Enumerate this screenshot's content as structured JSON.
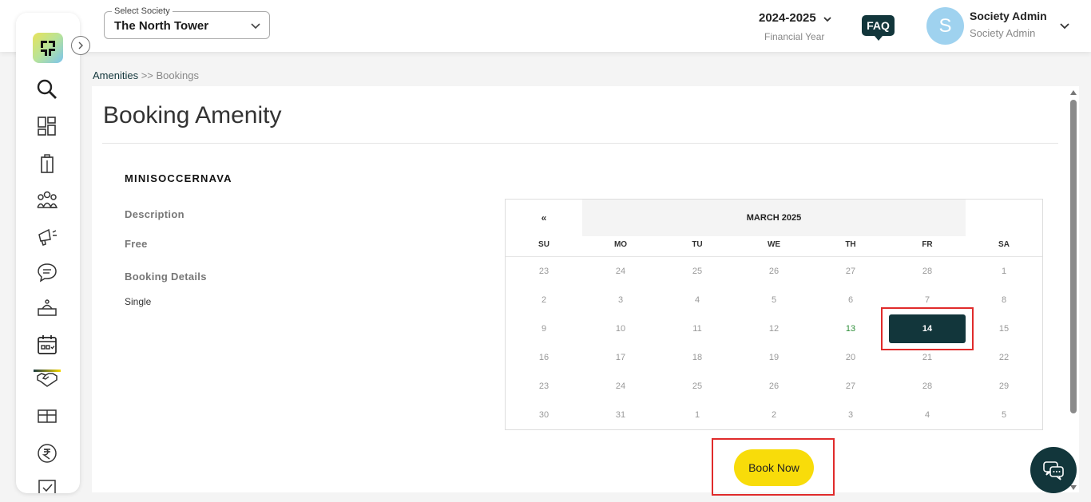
{
  "header": {
    "society_label": "Select Society",
    "society_value": "The North Tower",
    "financial_year": "2024-2025",
    "financial_year_label": "Financial Year",
    "faq_label": "FAQ",
    "avatar_initial": "S",
    "user_name": "Society Admin",
    "user_role": "Society Admin"
  },
  "breadcrumb": {
    "parent": "Amenities",
    "separator": ">>",
    "current": "Bookings"
  },
  "page": {
    "title": "Booking Amenity",
    "amenity_name": "MINISOCCERNAVA",
    "description_label": "Description",
    "fee": "Free",
    "booking_details_label": "Booking Details",
    "booking_type": "Single"
  },
  "calendar": {
    "prev_label": "«",
    "month_label": "MARCH 2025",
    "weekdays": [
      "SU",
      "MO",
      "TU",
      "WE",
      "TH",
      "FR",
      "SA"
    ],
    "weeks": [
      [
        "23",
        "24",
        "25",
        "26",
        "27",
        "28",
        "1"
      ],
      [
        "2",
        "3",
        "4",
        "5",
        "6",
        "7",
        "8"
      ],
      [
        "9",
        "10",
        "11",
        "12",
        "13",
        "14",
        "15"
      ],
      [
        "16",
        "17",
        "18",
        "19",
        "20",
        "21",
        "22"
      ],
      [
        "23",
        "24",
        "25",
        "26",
        "27",
        "28",
        "29"
      ],
      [
        "30",
        "31",
        "1",
        "2",
        "3",
        "4",
        "5"
      ]
    ],
    "today": "13",
    "selected": "14"
  },
  "actions": {
    "book_now": "Book Now"
  },
  "colors": {
    "primary_dark": "#12363b",
    "accent_yellow": "#f8dc0a",
    "highlight_red": "#e02b2b",
    "today_green": "#2f8f3a"
  }
}
